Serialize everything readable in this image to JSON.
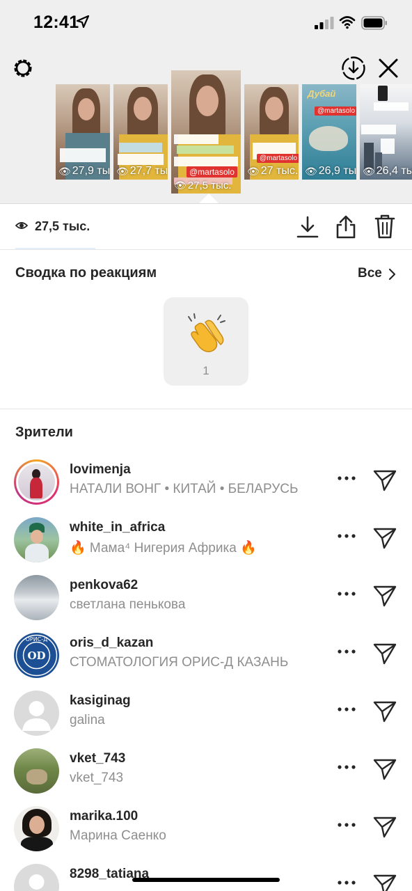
{
  "status_bar": {
    "time": "12:41"
  },
  "stories": [
    {
      "views": "27,9 тыс."
    },
    {
      "views": "27,7 тыс."
    },
    {
      "views": "27,5 тыс.",
      "tag": "@martasolo",
      "selected": true
    },
    {
      "views": "27 тыс.",
      "tag": "@martasolo"
    },
    {
      "views": "26,9 тыс.",
      "tag": "@martasolo",
      "title": "Дубай"
    },
    {
      "views": "26,4 тыс."
    }
  ],
  "stats": {
    "views": "27,5 тыс."
  },
  "reactions": {
    "title": "Сводка по реакциям",
    "all_label": "Все",
    "items": [
      {
        "emoji": "clapping-hands",
        "count": "1"
      }
    ]
  },
  "viewers": {
    "title": "Зрители",
    "items": [
      {
        "username": "lovimenja",
        "fullname": "НАТАЛИ ВОНГ • КИТАЙ • БЕЛАРУСЬ"
      },
      {
        "username": "white_in_africa",
        "fullname": "🔥 Мама⁴ Нигерия Африка 🔥"
      },
      {
        "username": "penkova62",
        "fullname": "светлана пенькова"
      },
      {
        "username": "oris_d_kazan",
        "fullname": "СТОМАТОЛОГИЯ ОРИС-Д КАЗАНЬ",
        "logo_text": "OD",
        "logo_ring": "ОРИС-Д"
      },
      {
        "username": "kasiginag",
        "fullname": "galina"
      },
      {
        "username": "vket_743",
        "fullname": "vket_743"
      },
      {
        "username": "marika.100",
        "fullname": "Марина  Саенко"
      },
      {
        "username": "8298_tatiana",
        "fullname": ""
      }
    ]
  },
  "colors": {
    "background_top": "#efefef",
    "text": "#262626",
    "secondary_text": "#8e8e8e",
    "story_ring_a": "#c13584",
    "story_ring_b": "#f5a623"
  }
}
